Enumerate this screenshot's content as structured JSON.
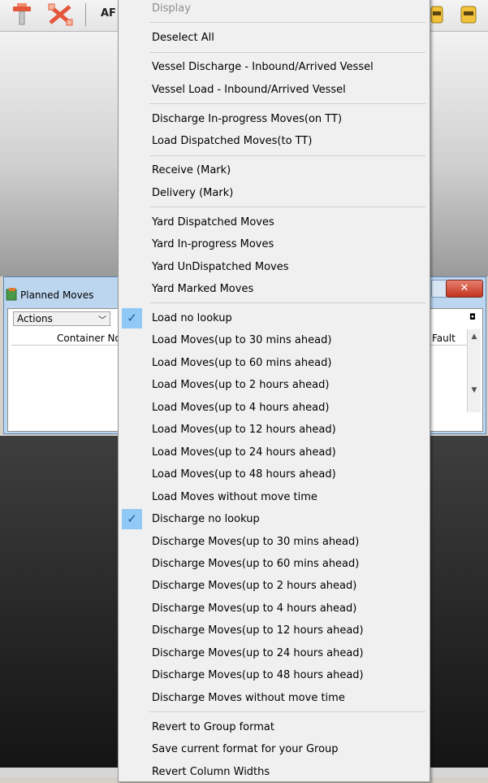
{
  "toolbar": {
    "app_label": "AF",
    "icons": [
      "tool-icon",
      "shuffle-icon",
      "alarm-icon",
      "alarm-icon"
    ]
  },
  "planned_moves": {
    "title": "Planned Moves",
    "actions_label": "Actions",
    "columns": [
      "Container No.",
      "Fault"
    ],
    "close_label": "✕"
  },
  "menu": {
    "items": [
      {
        "label": "Display",
        "disabled": true
      },
      {
        "label": "Deselect All"
      },
      {
        "label": "Vessel Discharge - Inbound/Arrived Vessel"
      },
      {
        "label": "Vessel Load - Inbound/Arrived Vessel"
      },
      {
        "label": "Discharge In-progress Moves(on TT)"
      },
      {
        "label": "Load Dispatched Moves(to TT)"
      },
      {
        "label": "Receive (Mark)"
      },
      {
        "label": "Delivery (Mark)"
      },
      {
        "label": "Yard Dispatched Moves"
      },
      {
        "label": "Yard In-progress Moves"
      },
      {
        "label": "Yard UnDispatched Moves"
      },
      {
        "label": "Yard Marked Moves"
      },
      {
        "label": "Load no lookup",
        "checked": true
      },
      {
        "label": "Load Moves(up to 30 mins ahead)"
      },
      {
        "label": "Load Moves(up to 60 mins ahead)"
      },
      {
        "label": "Load Moves(up to 2 hours ahead)"
      },
      {
        "label": "Load Moves(up to 4 hours ahead)"
      },
      {
        "label": "Load Moves(up to 12 hours ahead)"
      },
      {
        "label": "Load Moves(up to 24 hours ahead)"
      },
      {
        "label": "Load Moves(up to 48 hours ahead)"
      },
      {
        "label": "Load Moves without move time"
      },
      {
        "label": "Discharge no lookup",
        "checked": true
      },
      {
        "label": "Discharge Moves(up to 30 mins ahead)"
      },
      {
        "label": "Discharge Moves(up to 60 mins ahead)"
      },
      {
        "label": "Discharge Moves(up to 2 hours ahead)"
      },
      {
        "label": "Discharge Moves(up to 4 hours ahead)"
      },
      {
        "label": "Discharge Moves(up to 12 hours ahead)"
      },
      {
        "label": "Discharge Moves(up to 24 hours ahead)"
      },
      {
        "label": "Discharge Moves(up to 48 hours ahead)"
      },
      {
        "label": "Discharge Moves without move time"
      },
      {
        "label": "Revert to Group format"
      },
      {
        "label": "Save current format for your Group"
      },
      {
        "label": "Revert Column Widths"
      }
    ],
    "check_glyph": "✓"
  },
  "colors": {
    "check_bg": "#90c8f6",
    "close_red": "#c2331e",
    "window_frame": "#bcd6f0"
  }
}
